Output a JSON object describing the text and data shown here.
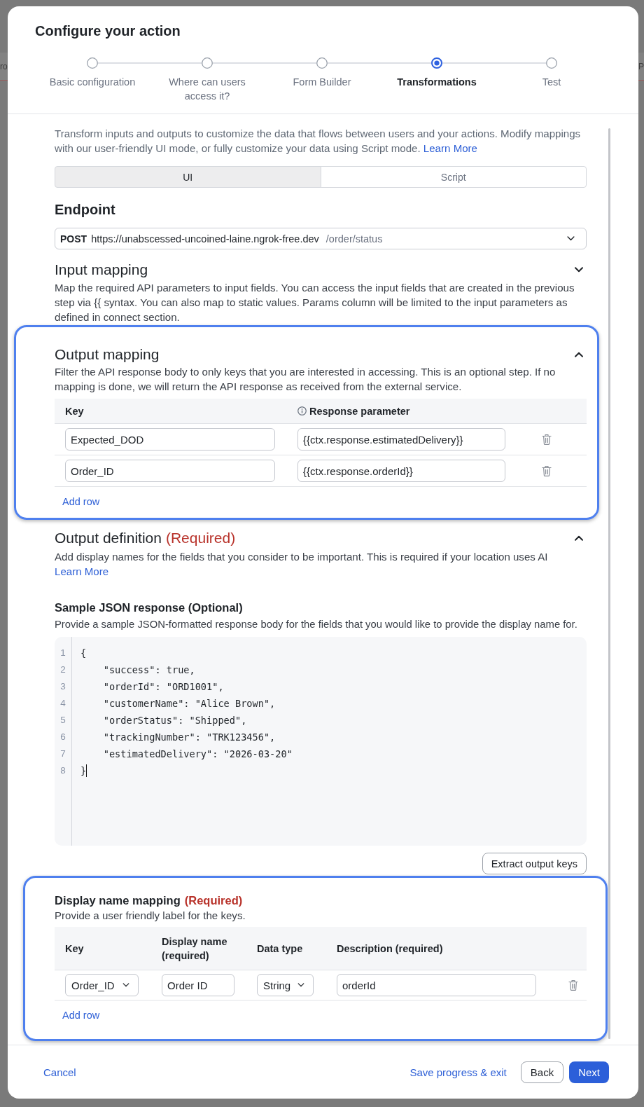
{
  "backdrop": {
    "left_fragment": "ro",
    "right_fragment": "P"
  },
  "modal": {
    "title": "Configure your action"
  },
  "stepper": [
    {
      "label": "Basic configuration",
      "selected": false
    },
    {
      "label": "Where can users access it?",
      "selected": false
    },
    {
      "label": "Form Builder",
      "selected": false
    },
    {
      "label": "Transformations",
      "selected": true
    },
    {
      "label": "Test",
      "selected": false
    }
  ],
  "intro": {
    "text": "Transform inputs and outputs to customize the data that flows between users and your actions. Modify mappings with our user-friendly UI mode, or fully customize your data using Script mode.",
    "link": "Learn More"
  },
  "mode_tabs": [
    {
      "label": "UI",
      "selected": true
    },
    {
      "label": "Script",
      "selected": false
    }
  ],
  "endpoint": {
    "heading": "Endpoint",
    "method": "POST",
    "base_url": "https://unabscessed-uncoined-laine.ngrok-free.dev",
    "path": "/order/status"
  },
  "input_mapping": {
    "heading": "Input mapping",
    "expanded": false,
    "description": "Map the required API parameters to input fields. You can access the input fields that are created in the previous step via {{ syntax. You can also map to static values. Params column will be limited to the input parameters as defined in connect section."
  },
  "output_mapping": {
    "heading": "Output mapping",
    "expanded": true,
    "highlighted": true,
    "description": "Filter the API response body to only keys that you are interested in accessing. This is an optional step. If no mapping is done, we will return the API response as received from the external service.",
    "columns": [
      "Key",
      "Response parameter"
    ],
    "rows": [
      {
        "key": "Expected_DOD",
        "response_parameter": "{{ctx.response.estimatedDelivery}}"
      },
      {
        "key": "Order_ID",
        "response_parameter": "{{ctx.response.orderId}}"
      }
    ],
    "add_row": "Add row"
  },
  "output_definition": {
    "heading": "Output definition",
    "required": "(Required)",
    "expanded": true,
    "description": "Add display names for the fields that you consider to be important. This is required if your location uses AI",
    "link": "Learn More",
    "sample": {
      "heading": "Sample JSON response (Optional)",
      "description": "Provide a sample JSON-formatted response body for the fields that you would like to provide the display name for.",
      "code_lines": [
        {
          "number": "1",
          "text": "{",
          "caret": false
        },
        {
          "number": "2",
          "text": "    \"success\": true,",
          "caret": false
        },
        {
          "number": "3",
          "text": "    \"orderId\": \"ORD1001\",",
          "caret": false
        },
        {
          "number": "4",
          "text": "    \"customerName\": \"Alice Brown\",",
          "caret": false
        },
        {
          "number": "5",
          "text": "    \"orderStatus\": \"Shipped\",",
          "caret": false
        },
        {
          "number": "6",
          "text": "    \"trackingNumber\": \"TRK123456\",",
          "caret": false
        },
        {
          "number": "7",
          "text": "    \"estimatedDelivery\": \"2026-03-20\"",
          "caret": false
        },
        {
          "number": "8",
          "text": "}",
          "caret": true
        }
      ]
    },
    "extract_button": "Extract output keys"
  },
  "display_name_mapping": {
    "heading": "Display name mapping",
    "required": "(Required)",
    "highlighted": true,
    "description": "Provide a user friendly label for the keys.",
    "columns": [
      "Key",
      "Display name (required)",
      "Data type",
      "Description (required)"
    ],
    "rows": [
      {
        "key": "Order_ID",
        "display_name": "Order ID",
        "data_type": "String",
        "description": "orderId"
      }
    ],
    "add_row": "Add row"
  },
  "footer": {
    "cancel": "Cancel",
    "save": "Save progress & exit",
    "back": "Back",
    "next": "Next"
  }
}
